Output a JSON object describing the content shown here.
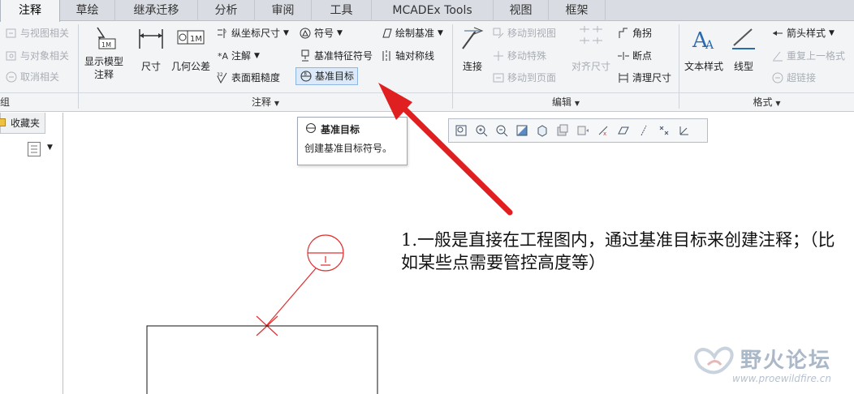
{
  "tabs": [
    "注释",
    "草绘",
    "继承迁移",
    "分析",
    "审阅",
    "工具",
    "MCADEx Tools",
    "视图",
    "框架"
  ],
  "ribbon": {
    "assoc": {
      "link_view": "与视图相关",
      "link_object": "与对象相关",
      "unlink": "取消相关",
      "footer": "组"
    },
    "annotation": {
      "show_model": "显示模型\n注释",
      "dimension": "尺寸",
      "gtol": "几何公差",
      "ordinate": "纵坐标尺寸",
      "note": "注解",
      "surface_finish": "表面粗糙度",
      "symbol": "符号",
      "datum_feature_symbol": "基准特征符号",
      "datum_target": "基准目标",
      "draw_datum": "绘制基准",
      "axis_symmetry": "轴对称线",
      "footer": "注释"
    },
    "edit": {
      "connect": "连接",
      "move_to_view": "移动到视图",
      "move_special": "移动特殊",
      "move_to_page": "移动到页面",
      "align_dims": "对齐尺寸",
      "jog": "角拐",
      "break_point": "断点",
      "clean_dims": "清理尺寸",
      "footer": "编辑"
    },
    "format": {
      "text_style": "文本样式",
      "line_style": "线型",
      "arrow_style": "箭头样式",
      "repeat_last": "重复上一格式",
      "hyperlink": "超链接",
      "footer": "格式"
    }
  },
  "tooltip": {
    "title": "基准目标",
    "description": "创建基准目标符号。"
  },
  "left_panel": {
    "favorites": "收藏夹"
  },
  "canvas": {
    "note_text": "1.一般是直接在工程图内，通过基准目标来创建注释；（比如某些点需要管控高度等）"
  },
  "watermark": {
    "title": "野火论坛",
    "url": "www.proewildfire.cn"
  },
  "colors": {
    "arrow": "#e02020",
    "highlight": "#dbe9f8",
    "annotation_red": "#e03030"
  }
}
